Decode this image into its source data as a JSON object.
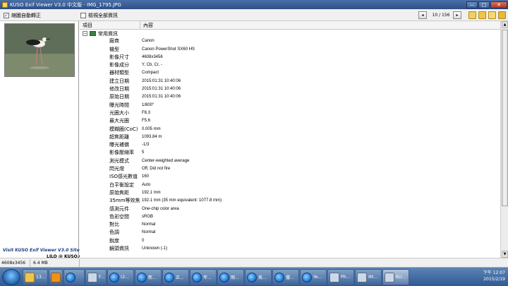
{
  "window": {
    "title": "KUSO Exif Viewer V3.0 中文版 - IMG_1795.JPG",
    "minimize": "—",
    "maximize": "□",
    "close": "✕"
  },
  "toolbar": {
    "auto_rotate_label": "縮圖自動轉正",
    "auto_rotate_checked": "✓",
    "show_all_label": "檢視全部資訊",
    "counter": "10 / 156",
    "prev": "◂",
    "next": "▸"
  },
  "left_pane": {
    "promo_line": "Visit KUSO Exif Viewer V3.0 Site",
    "credit": "LILO @ KUSO.CC"
  },
  "table": {
    "col_item": "項目",
    "col_value": "內容",
    "group": "常用資訊",
    "expand_symbol": "−",
    "rows": [
      {
        "label": "廠商",
        "value": "Canon"
      },
      {
        "label": "機型",
        "value": "Canon PowerShot SX60 HS"
      },
      {
        "label": "影像尺寸",
        "value": "4608x3456"
      },
      {
        "label": "影像成分",
        "value": "Y, Cb, Cr, -"
      },
      {
        "label": "器材類型",
        "value": "Compact"
      },
      {
        "label": "建立日期",
        "value": "2015:01:31 10:40:06"
      },
      {
        "label": "修改日期",
        "value": "2015:01:31 10:40:06"
      },
      {
        "label": "原始日期",
        "value": "2015:01:31 10:40:06"
      },
      {
        "label": "曝光時間",
        "value": "1/800\""
      },
      {
        "label": "光圈大小",
        "value": "F6.3"
      },
      {
        "label": "最大光圈",
        "value": "F5.6"
      },
      {
        "label": "模糊圈(CoC)",
        "value": "0.005 mm"
      },
      {
        "label": "超焦距離",
        "value": "1093.84 m"
      },
      {
        "label": "曝光補償",
        "value": "-1/3"
      },
      {
        "label": "影像壓縮率",
        "value": "5"
      },
      {
        "label": "測光模式",
        "value": "Center-weighted average"
      },
      {
        "label": "閃光燈",
        "value": "Off, Did not fire"
      },
      {
        "label": "ISO感光數值",
        "value": "160"
      },
      {
        "label": "白平衡設定",
        "value": "Auto"
      },
      {
        "label": "原始焦距",
        "value": "192.1 mm"
      },
      {
        "label": "35mm等效焦距",
        "value": "192.1 mm (35 mm equivalent: 1077.8 mm)"
      },
      {
        "label": "感測元件",
        "value": "One-chip color area"
      },
      {
        "label": "色彩空間",
        "value": "sRGB"
      },
      {
        "label": "對比",
        "value": "Normal"
      },
      {
        "label": "色調",
        "value": "Normal"
      },
      {
        "label": "銳度",
        "value": "0"
      },
      {
        "label": "鏡頭資訊",
        "value": "Unknown (-1)"
      }
    ]
  },
  "status": {
    "dimensions": "4608x3456",
    "size": "6.4 MB"
  },
  "taskbar": {
    "tasks": [
      {
        "label": "13...",
        "icon": "folder-icon"
      },
      {
        "label": "",
        "icon": "media-player-icon"
      },
      {
        "label": "",
        "icon": "ie-icon"
      },
      {
        "label": "F...",
        "icon": "app-icon"
      },
      {
        "label": "(2...",
        "icon": "ie-icon"
      },
      {
        "label": "新...",
        "icon": "ie-icon"
      },
      {
        "label": "正...",
        "icon": "ie-icon"
      },
      {
        "label": "年...",
        "icon": "ie-icon"
      },
      {
        "label": "剛...",
        "icon": "ie-icon"
      },
      {
        "label": "美...",
        "icon": "ie-icon"
      },
      {
        "label": "優...",
        "icon": "ie-icon"
      },
      {
        "label": "Ye...",
        "icon": "ie-icon"
      },
      {
        "label": "Ph...",
        "icon": "app-icon"
      },
      {
        "label": "IM...",
        "icon": "app-icon"
      },
      {
        "label": "KU...",
        "icon": "app-icon"
      }
    ],
    "clock_time": "下午 12:07",
    "clock_date": "2015/2/19"
  }
}
